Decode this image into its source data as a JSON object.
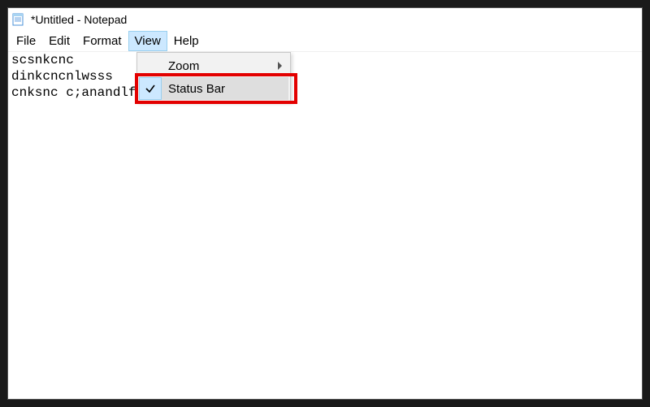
{
  "titlebar": {
    "title": "*Untitled - Notepad"
  },
  "menubar": {
    "file": "File",
    "edit": "Edit",
    "format": "Format",
    "view": "View",
    "help": "Help"
  },
  "dropdown": {
    "zoom": "Zoom",
    "status_bar": "Status Bar"
  },
  "editor": {
    "content": "scsnkcnc\ndinkcncnlwsss\ncnksnc c;anandlfanm.a"
  }
}
